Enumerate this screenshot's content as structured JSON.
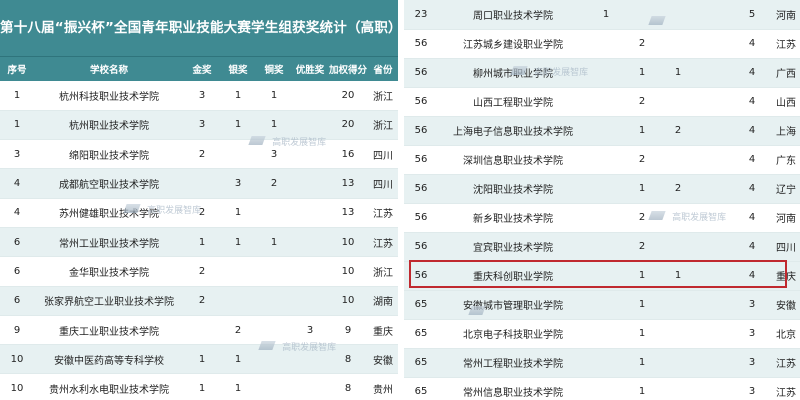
{
  "left_table": {
    "title": "第十八届“振兴杯”全国青年职业技能大赛学生组获奖统计（高职）",
    "headers": [
      "序号",
      "学校名称",
      "金奖",
      "银奖",
      "铜奖",
      "优胜奖",
      "加权得分",
      "省份"
    ],
    "rows": [
      [
        "1",
        "杭州科技职业技术学院",
        "3",
        "1",
        "1",
        "",
        "20",
        "浙江"
      ],
      [
        "1",
        "杭州职业技术学院",
        "3",
        "1",
        "1",
        "",
        "20",
        "浙江"
      ],
      [
        "3",
        "绵阳职业技术学院",
        "2",
        "",
        "3",
        "",
        "16",
        "四川"
      ],
      [
        "4",
        "成都航空职业技术学院",
        "",
        "3",
        "2",
        "",
        "13",
        "四川"
      ],
      [
        "4",
        "苏州健雄职业技术学院",
        "2",
        "1",
        "",
        "",
        "13",
        "江苏"
      ],
      [
        "6",
        "常州工业职业技术学院",
        "1",
        "1",
        "1",
        "",
        "10",
        "江苏"
      ],
      [
        "6",
        "金华职业技术学院",
        "2",
        "",
        "",
        "",
        "10",
        "浙江"
      ],
      [
        "6",
        "张家界航空工业职业技术学院",
        "2",
        "",
        "",
        "",
        "10",
        "湖南"
      ],
      [
        "9",
        "重庆工业职业技术学院",
        "",
        "2",
        "",
        "3",
        "9",
        "重庆"
      ],
      [
        "10",
        "安徽中医药高等专科学校",
        "1",
        "1",
        "",
        "",
        "8",
        "安徽"
      ],
      [
        "10",
        "贵州水利水电职业技术学院",
        "1",
        "1",
        "",
        "",
        "8",
        "贵州"
      ]
    ]
  },
  "right_table": {
    "rows": [
      [
        "23",
        "周口职业技术学院",
        "1",
        "",
        "",
        "",
        "5",
        "河南"
      ],
      [
        "56",
        "江苏城乡建设职业学院",
        "",
        "2",
        "",
        "",
        "4",
        "江苏"
      ],
      [
        "56",
        "柳州城市职业学院",
        "",
        "1",
        "1",
        "",
        "4",
        "广西"
      ],
      [
        "56",
        "山西工程职业学院",
        "",
        "2",
        "",
        "",
        "4",
        "山西"
      ],
      [
        "56",
        "上海电子信息职业技术学院",
        "",
        "1",
        "2",
        "",
        "4",
        "上海"
      ],
      [
        "56",
        "深圳信息职业技术学院",
        "",
        "2",
        "",
        "",
        "4",
        "广东"
      ],
      [
        "56",
        "沈阳职业技术学院",
        "",
        "1",
        "2",
        "",
        "4",
        "辽宁"
      ],
      [
        "56",
        "新乡职业技术学院",
        "",
        "2",
        "",
        "",
        "4",
        "河南"
      ],
      [
        "56",
        "宜宾职业技术学院",
        "",
        "2",
        "",
        "",
        "4",
        "四川"
      ],
      [
        "56",
        "重庆科创职业学院",
        "",
        "1",
        "1",
        "",
        "4",
        "重庆"
      ],
      [
        "65",
        "安徽城市管理职业学院",
        "",
        "1",
        "",
        "",
        "3",
        "安徽"
      ],
      [
        "65",
        "北京电子科技职业学院",
        "",
        "1",
        "",
        "",
        "3",
        "北京"
      ],
      [
        "65",
        "常州工程职业技术学院",
        "",
        "1",
        "",
        "",
        "3",
        "江苏"
      ],
      [
        "65",
        "常州信息职业技术学院",
        "",
        "1",
        "",
        "",
        "3",
        "江苏"
      ]
    ]
  },
  "watermark": {
    "text": "高职发展智库"
  },
  "colors": {
    "header_bg": "#3f8a92",
    "stripe": "#e7f1f2",
    "highlight_border": "#c0292f"
  }
}
